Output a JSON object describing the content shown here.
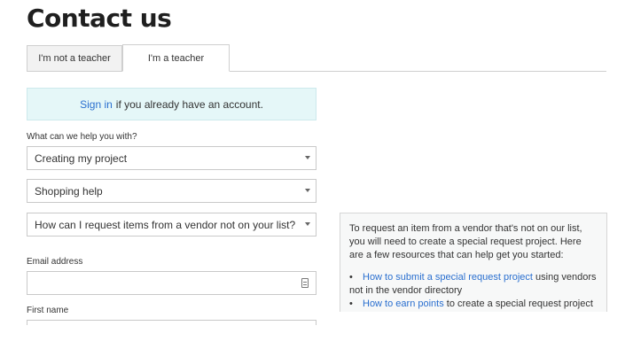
{
  "page": {
    "title": "Contact us"
  },
  "tabs": [
    {
      "label": "I'm not a teacher",
      "active": false
    },
    {
      "label": "I'm a teacher",
      "active": true
    }
  ],
  "signin": {
    "link": "Sign in",
    "text": "if you already have an account."
  },
  "form": {
    "help_label": "What can we help you with?",
    "selects": [
      {
        "value": "Creating my project"
      },
      {
        "value": "Shopping help"
      },
      {
        "value": "How can I request items from a vendor not on your list?"
      }
    ],
    "email_label": "Email address",
    "email_value": "",
    "first_name_label": "First name"
  },
  "tooltip": {
    "intro": "To request an item from a vendor that's not on our list, you will need to create a special request project. Here are a few resources that can help get you started:",
    "items": [
      {
        "link": "How to submit a special request project",
        "text": "using vendors not in the vendor directory"
      },
      {
        "link": "How to earn points",
        "text": "to create a special request project"
      }
    ]
  },
  "colors": {
    "link": "#2a6fcf",
    "signin_bg": "#e5f7f8"
  }
}
